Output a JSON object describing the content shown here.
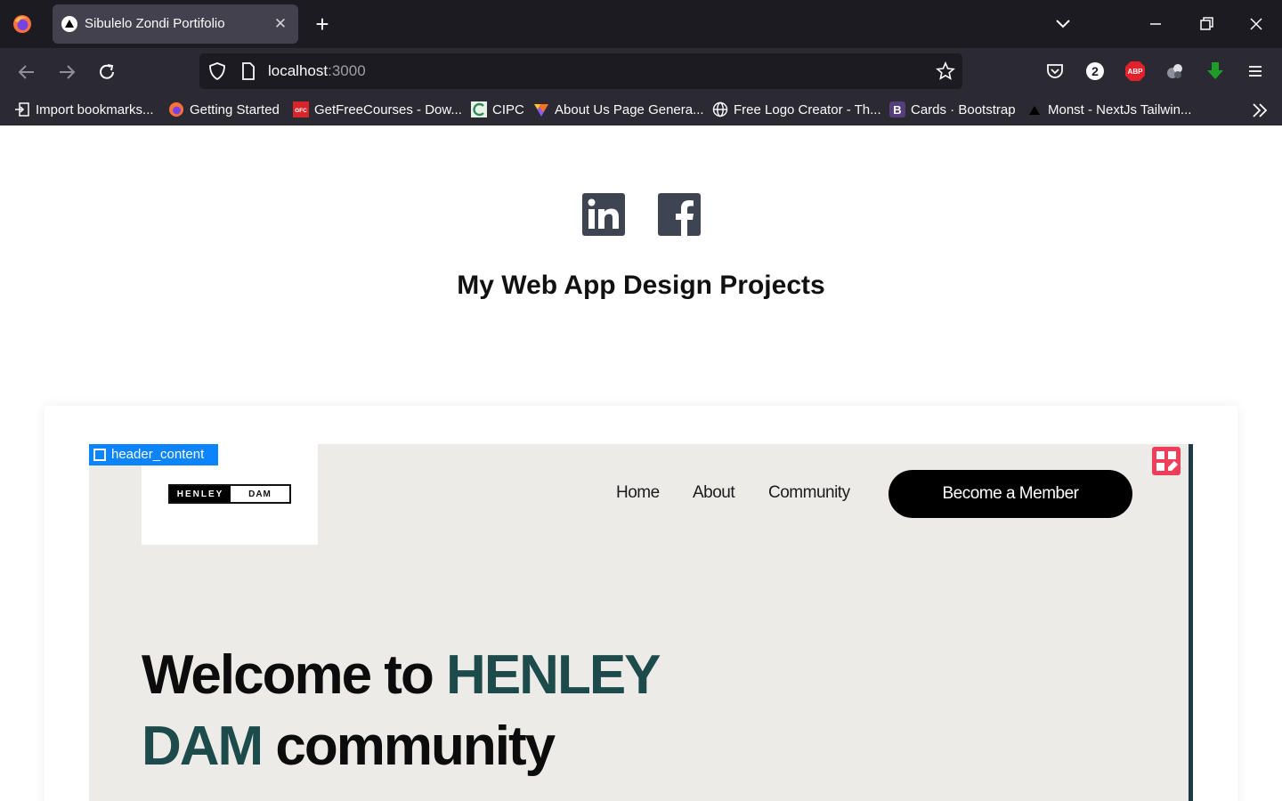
{
  "browser": {
    "tab": {
      "title": "Sibulelo Zondi Portifolio",
      "close": "✕"
    },
    "new_tab": "+",
    "url": {
      "host": "localhost",
      "port": ":3000"
    },
    "extensions": {
      "badge_count": "2",
      "abp": "ABP"
    },
    "bookmarks": [
      {
        "label": "Import bookmarks...",
        "icon": "import-icon"
      },
      {
        "label": "Getting Started",
        "icon": "firefox-icon"
      },
      {
        "label": "GetFreeCourses - Dow...",
        "icon": "gfc-icon"
      },
      {
        "label": "CIPC",
        "icon": "cipc-icon"
      },
      {
        "label": "About Us Page Genera...",
        "icon": "heart-icon"
      },
      {
        "label": "Free Logo Creator - Th...",
        "icon": "globe-icon"
      },
      {
        "label": "Cards · Bootstrap",
        "icon": "bootstrap-icon"
      },
      {
        "label": "Monst - NextJs Tailwin...",
        "icon": "triangle-icon"
      }
    ]
  },
  "page": {
    "title": "My Web App Design Projects",
    "social": [
      "linkedin-icon",
      "facebook-icon"
    ],
    "project": {
      "tag": "header_content",
      "logo": {
        "left": "HENLEY",
        "right": "DAM"
      },
      "nav": [
        "Home",
        "About",
        "Community"
      ],
      "cta": "Become a Member",
      "hero": {
        "line1": "Welcome to ",
        "accent1": "HENLEY",
        "accent2": "DAM",
        "line2": " community"
      },
      "colors": {
        "accent": "#1d4a4a",
        "button": "#000000"
      }
    }
  }
}
